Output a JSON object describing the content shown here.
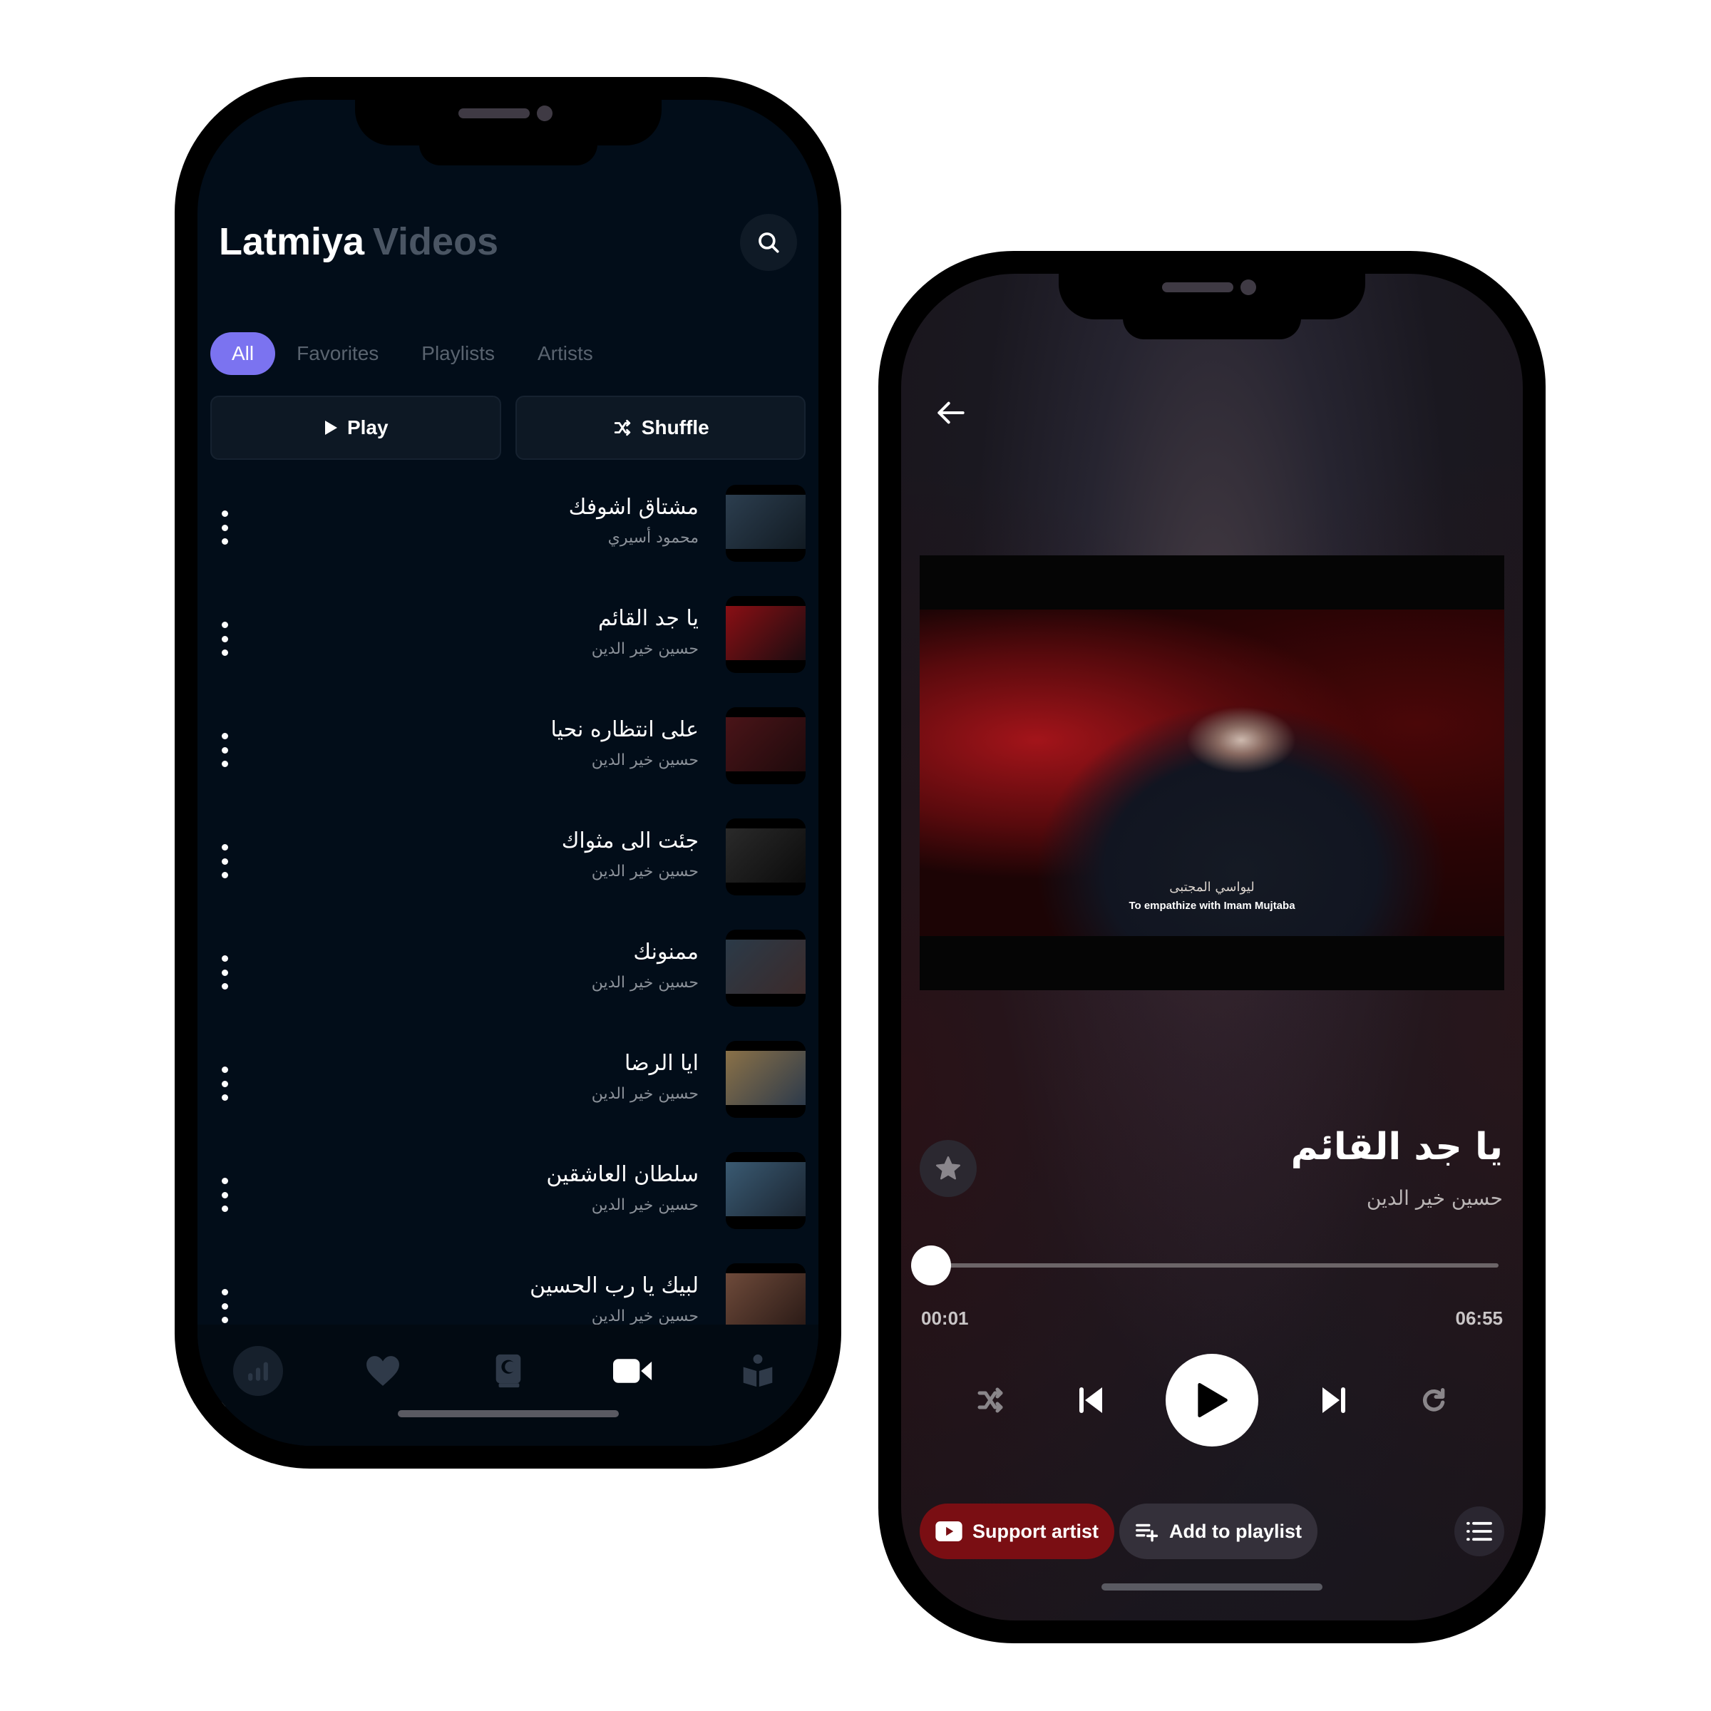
{
  "library_screen": {
    "header": {
      "title": "Latmiya",
      "subtitle": "Videos",
      "search_icon": "search-icon"
    },
    "tabs": [
      {
        "label": "All",
        "active": true
      },
      {
        "label": "Favorites",
        "active": false
      },
      {
        "label": "Playlists",
        "active": false
      },
      {
        "label": "Artists",
        "active": false
      }
    ],
    "actions": {
      "play_label": "Play",
      "shuffle_label": "Shuffle"
    },
    "videos": [
      {
        "title": "مشتاق اشوفك",
        "artist": "محمود أسيري",
        "thumb_colors": [
          "#2c3e4f",
          "#111a22"
        ]
      },
      {
        "title": "يا جد القائم",
        "artist": "حسين خير الدين",
        "thumb_colors": [
          "#8a0f14",
          "#1a0c10"
        ]
      },
      {
        "title": "على انتظاره نحيا",
        "artist": "حسين خير الدين",
        "thumb_colors": [
          "#4a1418",
          "#1e0a0c"
        ]
      },
      {
        "title": "جئت الى مثواك",
        "artist": "حسين خير الدين",
        "thumb_colors": [
          "#2a2a2a",
          "#0b0b0b"
        ]
      },
      {
        "title": "ممنونك",
        "artist": "حسين خير الدين",
        "thumb_colors": [
          "#2b3a48",
          "#3b2a2a"
        ]
      },
      {
        "title": "ايا الرضا",
        "artist": "حسين خير الدين",
        "thumb_colors": [
          "#8a7148",
          "#2d3a4a"
        ]
      },
      {
        "title": "سلطان العاشقين",
        "artist": "حسين خير الدين",
        "thumb_colors": [
          "#3a5a72",
          "#1a2430"
        ]
      },
      {
        "title": "لبيك يا رب الحسين",
        "artist": "حسين خير الدين",
        "thumb_colors": [
          "#6e4a3a",
          "#2a1a16"
        ]
      },
      {
        "title": "",
        "artist": "",
        "thumb_colors": [
          "#3a2018",
          "#140a08"
        ]
      }
    ],
    "nav": [
      {
        "icon": "stats-icon",
        "active": false
      },
      {
        "icon": "heart-icon",
        "active": false
      },
      {
        "icon": "quran-book-icon",
        "active": false
      },
      {
        "icon": "video-camera-icon",
        "active": true
      },
      {
        "icon": "reader-icon",
        "active": false
      }
    ]
  },
  "player_screen": {
    "back_icon": "arrow-left-icon",
    "video": {
      "subtitle_ar": "ليواسي المجتبى",
      "subtitle_en": "To empathize with Imam Mujtaba"
    },
    "now_playing": {
      "title": "يا جد القائم",
      "artist": "حسين خير الدين"
    },
    "progress": {
      "current": "00:01",
      "duration": "06:55",
      "fraction": 0.0024
    },
    "controls": [
      "shuffle-icon",
      "skip-previous-icon",
      "play-icon",
      "skip-next-icon",
      "repeat-icon"
    ],
    "buttons": {
      "support_label": "Support artist",
      "add_playlist_label": "Add to playlist"
    },
    "colors": {
      "support": "#7a0e13",
      "accent": "#7b73f0"
    }
  }
}
